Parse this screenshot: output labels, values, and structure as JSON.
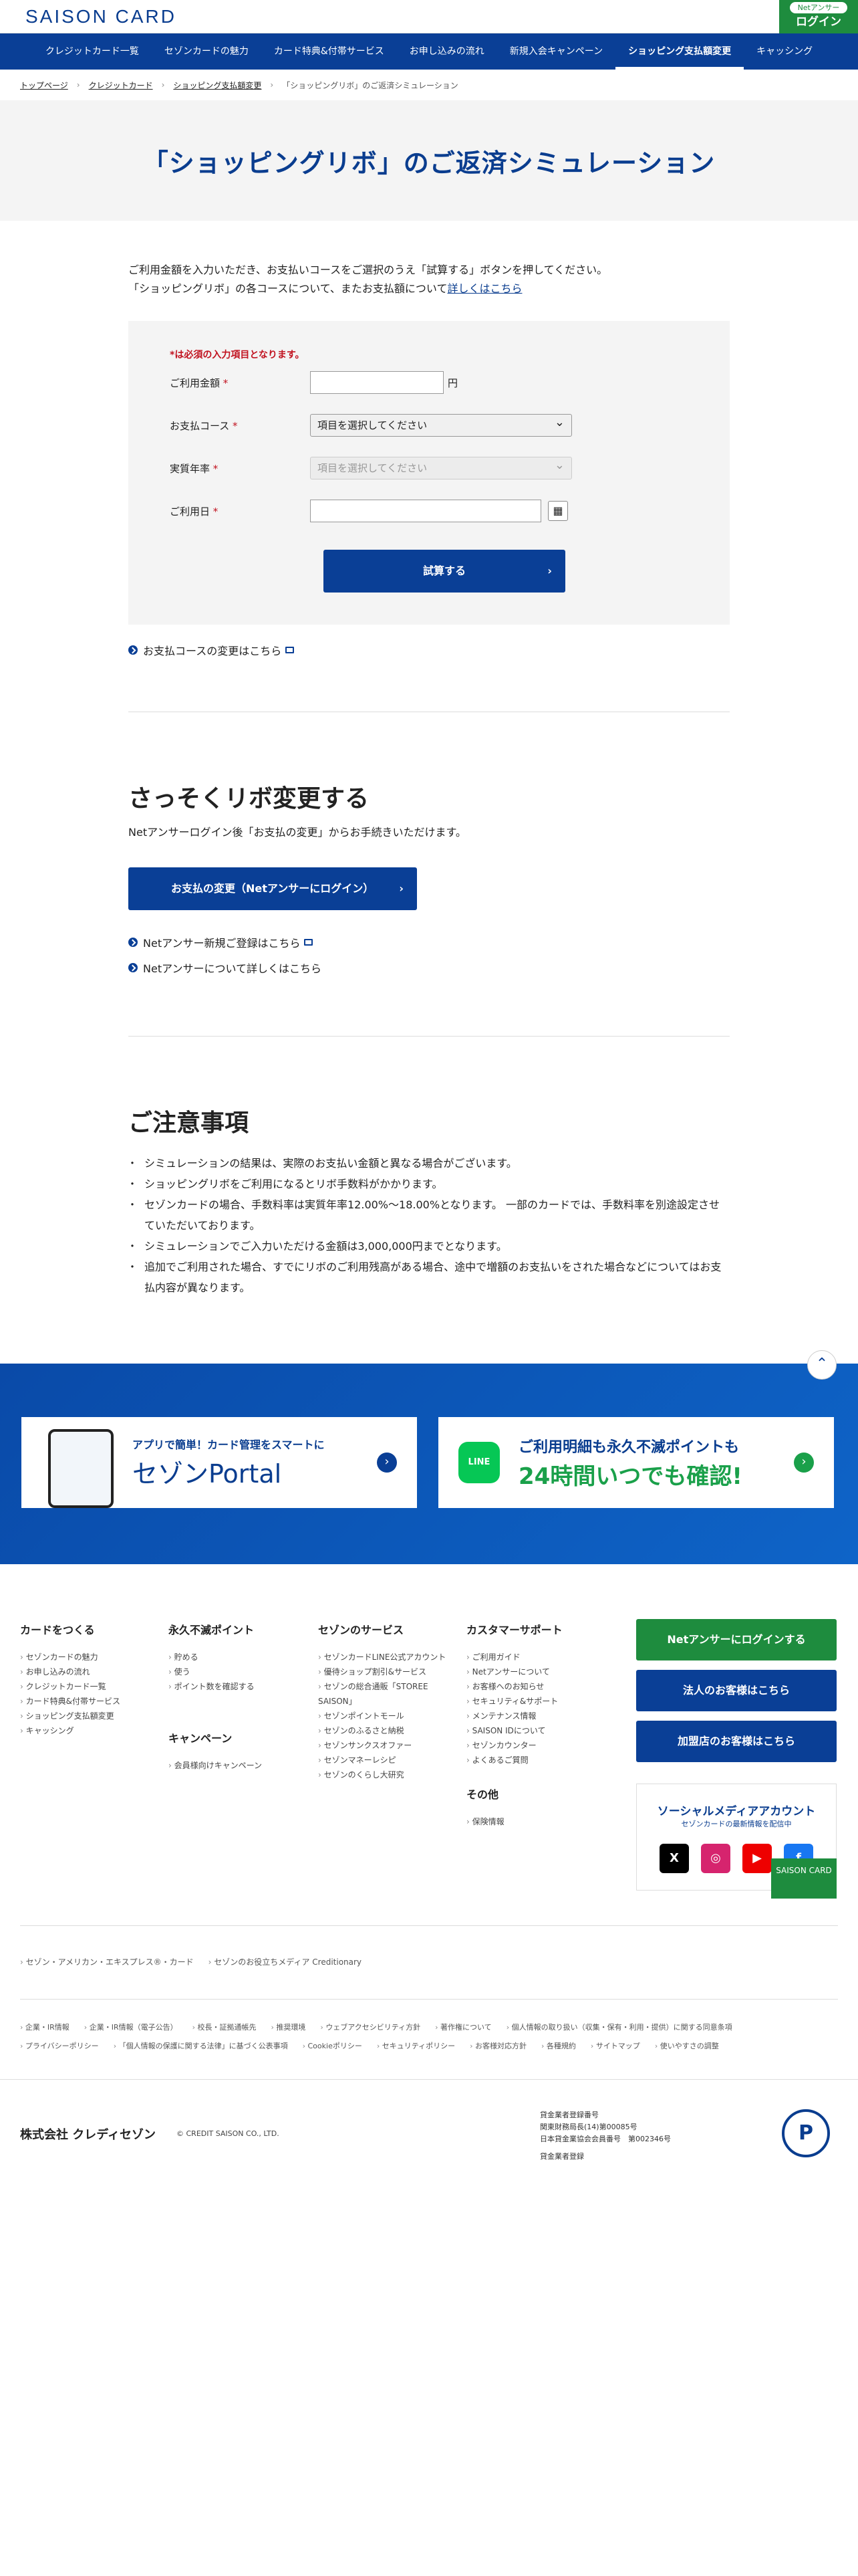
{
  "header": {
    "brand": "SAISON CARD",
    "netanswer": "Netアンサー",
    "login": "ログイン"
  },
  "nav": [
    "クレジットカード一覧",
    "セゾンカードの魅力",
    "カード特典&付帯サービス",
    "お申し込みの流れ",
    "新規入会キャンペーン",
    "ショッピング支払額変更",
    "キャッシング"
  ],
  "breadcrumb": [
    "トップページ",
    "クレジットカード",
    "ショッピング支払額変更",
    "「ショッピングリボ」のご返済シミュレーション"
  ],
  "title": "「ショッピングリボ」のご返済シミュレーション",
  "intro": {
    "line1": "ご利用金額を入力いただき、お支払いコースをご選択のうえ「試算する」ボタンを押してください。",
    "line2": "「ショッピングリボ」の各コースについて、またお支払額について",
    "link": "詳しくはこちら"
  },
  "form": {
    "required_note": "*は必須の入力項目となります。",
    "amount_label": "ご利用金額",
    "unit": "円",
    "course_label": "お支払コース",
    "course_value": "項目を選択してください",
    "rate_label": "実質年率",
    "rate_value": "項目を選択してください",
    "date_label": "ご利用日",
    "submit": "試算する",
    "star": "*"
  },
  "change_course_link": "お支払コースの変更はこちら",
  "section2": {
    "title": "さっそくリボ変更する",
    "text": "Netアンサーログイン後「お支払の変更」からお手続きいただけます。",
    "button": "お支払の変更（Netアンサーにログイン）",
    "link1": "Netアンサー新規ご登録はこちら",
    "link2": "Netアンサーについて詳しくはこちら"
  },
  "notes": {
    "title": "ご注意事項",
    "items": [
      "シミュレーションの結果は、実際のお支払い金額と異なる場合がございます。",
      "ショッピングリボをご利用になるとリボ手数料がかかります。",
      "セゾンカードの場合、手数料率は実質年率12.00%〜18.00%となります。 一部のカードでは、手数料率を別途設定させていただいております。",
      "シミュレーションでご入力いただける金額は3,000,000円までとなります。",
      "追加でご利用された場合、すでにリボのご利用残高がある場合、途中で増額のお支払いをされた場合などについてはお支払内容が異なります。"
    ]
  },
  "banners": {
    "portal_t1": "アプリで簡単！カード管理をスマートに",
    "portal_t2": "セゾンPortal",
    "line_t1": "ご利用明細も永久不滅ポイントも",
    "line_t2": "24時間いつでも確認!",
    "line_icon": "LINE"
  },
  "footer": {
    "col1": {
      "title": "カードをつくる",
      "items": [
        "セゾンカードの魅力",
        "お申し込みの流れ",
        "クレジットカード一覧",
        "カード特典&付帯サービス",
        "ショッピング支払額変更",
        "キャッシング"
      ]
    },
    "col2": {
      "title": "永久不滅ポイント",
      "items": [
        "貯める",
        "使う",
        "ポイント数を確認する"
      ]
    },
    "col2b": {
      "title": "キャンペーン",
      "items": [
        "会員様向けキャンペーン"
      ]
    },
    "col3": {
      "title": "セゾンのサービス",
      "items": [
        "セゾンカードLINE公式アカウント",
        "優待ショップ割引&サービス",
        "セゾンの総合通販「STOREE SAISON」",
        "セゾンポイントモール",
        "セゾンのふるさと納税",
        "セゾンサンクスオファー",
        "セゾンマネーレシピ",
        "セゾンのくらし大研究"
      ]
    },
    "col4": {
      "title": "カスタマーサポート",
      "items": [
        "ご利用ガイド",
        "Netアンサーについて",
        "お客様へのお知らせ",
        "セキュリティ&サポート",
        "メンテナンス情報",
        "SAISON IDについて",
        "セゾンカウンター",
        "よくあるご質問"
      ]
    },
    "col4b": {
      "title": "その他",
      "items": [
        "保険情報"
      ]
    },
    "btn_login": "Netアンサーにログインする",
    "btn_corp": "法人のお客様はこちら",
    "btn_shop": "加盟店のお客様はこちら",
    "sns_title": "ソーシャルメディアアカウント",
    "sns_sub": "セゾンカードの最新情報を配信中",
    "sns_icons": [
      "X",
      "◎",
      "▶",
      "f"
    ],
    "links1": [
      "セゾン・アメリカン・エキスプレス®・カード",
      "セゾンのお役立ちメディア Creditionary"
    ],
    "links2": [
      "企業・IR情報",
      "企業・IR情報（電子公告）",
      "校長・証拠通帳先",
      "推奨環境",
      "ウェブアクセシビリティ方針",
      "著作権について",
      "個人情報の取り扱い（収集・保有・利用・提供）に関する同意条項"
    ],
    "links3": [
      "プライバシーポリシー",
      "「個人情報の保護に関する法律」に基づく公表事項",
      "Cookieポリシー",
      "セキュリティポリシー",
      "お客様対応方針",
      "各種規約",
      "サイトマップ",
      "使いやすさの調整"
    ],
    "company": "株式会社 クレディセゾン",
    "copyright": "© CREDIT SAISON CO., LTD.",
    "reg1": "貸金業者登録番号",
    "reg2": "関東財務局長(14)第00085号",
    "reg3": "日本貸金業協会会員番号　第002346号",
    "reg_link": "貸金業者登録",
    "saison_badge": "SAISON CARD"
  }
}
